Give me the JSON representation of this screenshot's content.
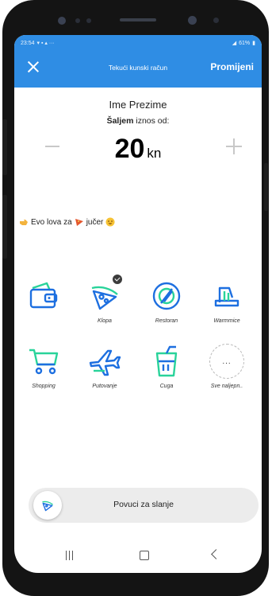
{
  "status_bar": {
    "time": "23:54",
    "battery": "61%"
  },
  "toolbar": {
    "title": "Tekući kunski račun",
    "action_label": "Promijeni"
  },
  "recipient": {
    "name": "Ime Prezime"
  },
  "sending": {
    "bold": "Šaljem",
    "rest": " iznos od:"
  },
  "amount": {
    "value": "20",
    "currency": "kn"
  },
  "message": {
    "part1": "Evo lova za",
    "part2": "jučer"
  },
  "categories": [
    {
      "label": "",
      "icon": "wallet-icon"
    },
    {
      "label": "Klopa",
      "icon": "pizza-icon",
      "selected": true
    },
    {
      "label": "Restoran",
      "icon": "plate-icon"
    },
    {
      "label": "Warmmice",
      "icon": "vacuum-icon"
    },
    {
      "label": "Shopping",
      "icon": "cart-icon"
    },
    {
      "label": "Putovanje",
      "icon": "airplane-icon"
    },
    {
      "label": "Cuga",
      "icon": "drink-icon"
    },
    {
      "label": "Sve naljepn..",
      "icon": "more-icon",
      "glyph": "..."
    }
  ],
  "swipe": {
    "label": "Povuci za slanje"
  },
  "colors": {
    "accent": "#2f8de4",
    "icon_blue": "#1d6fe0",
    "icon_green": "#29d39a"
  }
}
